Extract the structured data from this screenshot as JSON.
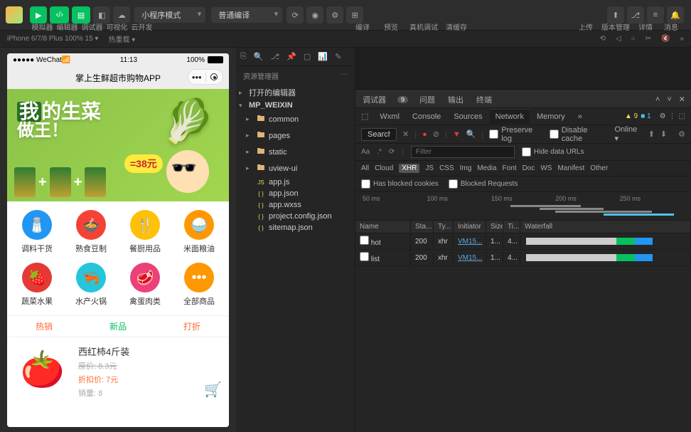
{
  "topbar": {
    "labels": [
      "模拟器",
      "编辑器",
      "调试器",
      "可视化",
      "云开发"
    ],
    "dropdown1": "小程序模式",
    "dropdown2": "普通编译",
    "mid_labels": [
      "编译",
      "预览",
      "真机调试",
      "清缓存"
    ],
    "right_labels": [
      "上传",
      "版本管理",
      "详情",
      "消息"
    ]
  },
  "devicebar": {
    "device": "iPhone 6/7/8 Plus 100% 15 ▾",
    "extra": "热重载 ▾"
  },
  "phone": {
    "wechat": "●●●●● WeChat",
    "wifi_icon": "📶",
    "time": "11:13",
    "battery_pct": "100%",
    "title": "掌上生鲜超市购物APP",
    "banner": {
      "text_prefix": "我",
      "text1": "的生菜",
      "text2": "做王！",
      "price": "=38元"
    },
    "grid": [
      {
        "label": "调料干货",
        "color": "#2196f3",
        "emoji": "🧂"
      },
      {
        "label": "熟食豆制",
        "color": "#f44336",
        "emoji": "🍲"
      },
      {
        "label": "餐厨用品",
        "color": "#ffc107",
        "emoji": "🍴"
      },
      {
        "label": "米面粮油",
        "color": "#ff9800",
        "emoji": "🍚"
      },
      {
        "label": "蔬菜水果",
        "color": "#e53935",
        "emoji": "🍓"
      },
      {
        "label": "水产火锅",
        "color": "#26c6da",
        "emoji": "🦐"
      },
      {
        "label": "禽蛋肉类",
        "color": "#ec407a",
        "emoji": "🥩"
      },
      {
        "label": "全部商品",
        "color": "#ff9800",
        "emoji": "•••"
      }
    ],
    "tabs": {
      "hot": "热销",
      "new": "新品",
      "discount": "打折"
    },
    "product": {
      "name": "西红柿4斤装",
      "old_price": "原价: 8.3元",
      "new_price": "折扣价: 7元",
      "sales": "销量: 8",
      "emoji": "🍅"
    }
  },
  "explorer": {
    "title": "资源管理器",
    "ellipsis": "···",
    "open_editor": "打开的编辑器",
    "root": "MP_WEIXIN",
    "folders": [
      "common",
      "pages",
      "static",
      "uview-ui"
    ],
    "files": [
      "app.js",
      "app.json",
      "app.wxss",
      "project.config.json",
      "sitemap.json"
    ]
  },
  "devtools": {
    "tabs1": {
      "debugger": "调试器",
      "badge": "9",
      "problem": "问题",
      "output": "输出",
      "terminal": "终端"
    },
    "tabs2": [
      "Wxml",
      "Console",
      "Sources",
      "Network",
      "Memory"
    ],
    "active_tab2": "Network",
    "warn_count": "9",
    "info_count": "1",
    "search_label": "Search",
    "preserve_log": "Preserve log",
    "disable_cache": "Disable cache",
    "online": "Online",
    "filter_placeholder": "Filter",
    "hide_data_urls": "Hide data URLs",
    "filter_types": [
      "All",
      "Cloud",
      "XHR",
      "JS",
      "CSS",
      "Img",
      "Media",
      "Font",
      "Doc",
      "WS",
      "Manifest",
      "Other"
    ],
    "active_filter": "XHR",
    "blocked_cookies": "Has blocked cookies",
    "blocked_requests": "Blocked Requests",
    "ticks": [
      "50 ms",
      "100 ms",
      "150 ms",
      "200 ms",
      "250 ms"
    ],
    "columns": {
      "name": "Name",
      "status": "Sta...",
      "type": "Ty...",
      "initiator": "Initiator",
      "size": "Size",
      "time": "Ti...",
      "waterfall": "Waterfall"
    },
    "rows": [
      {
        "name": "hot",
        "status": "200",
        "type": "xhr",
        "initiator": "VM15...",
        "size": "1...",
        "time": "4..."
      },
      {
        "name": "list",
        "status": "200",
        "type": "xhr",
        "initiator": "VM15...",
        "size": "1...",
        "time": "4..."
      }
    ]
  }
}
